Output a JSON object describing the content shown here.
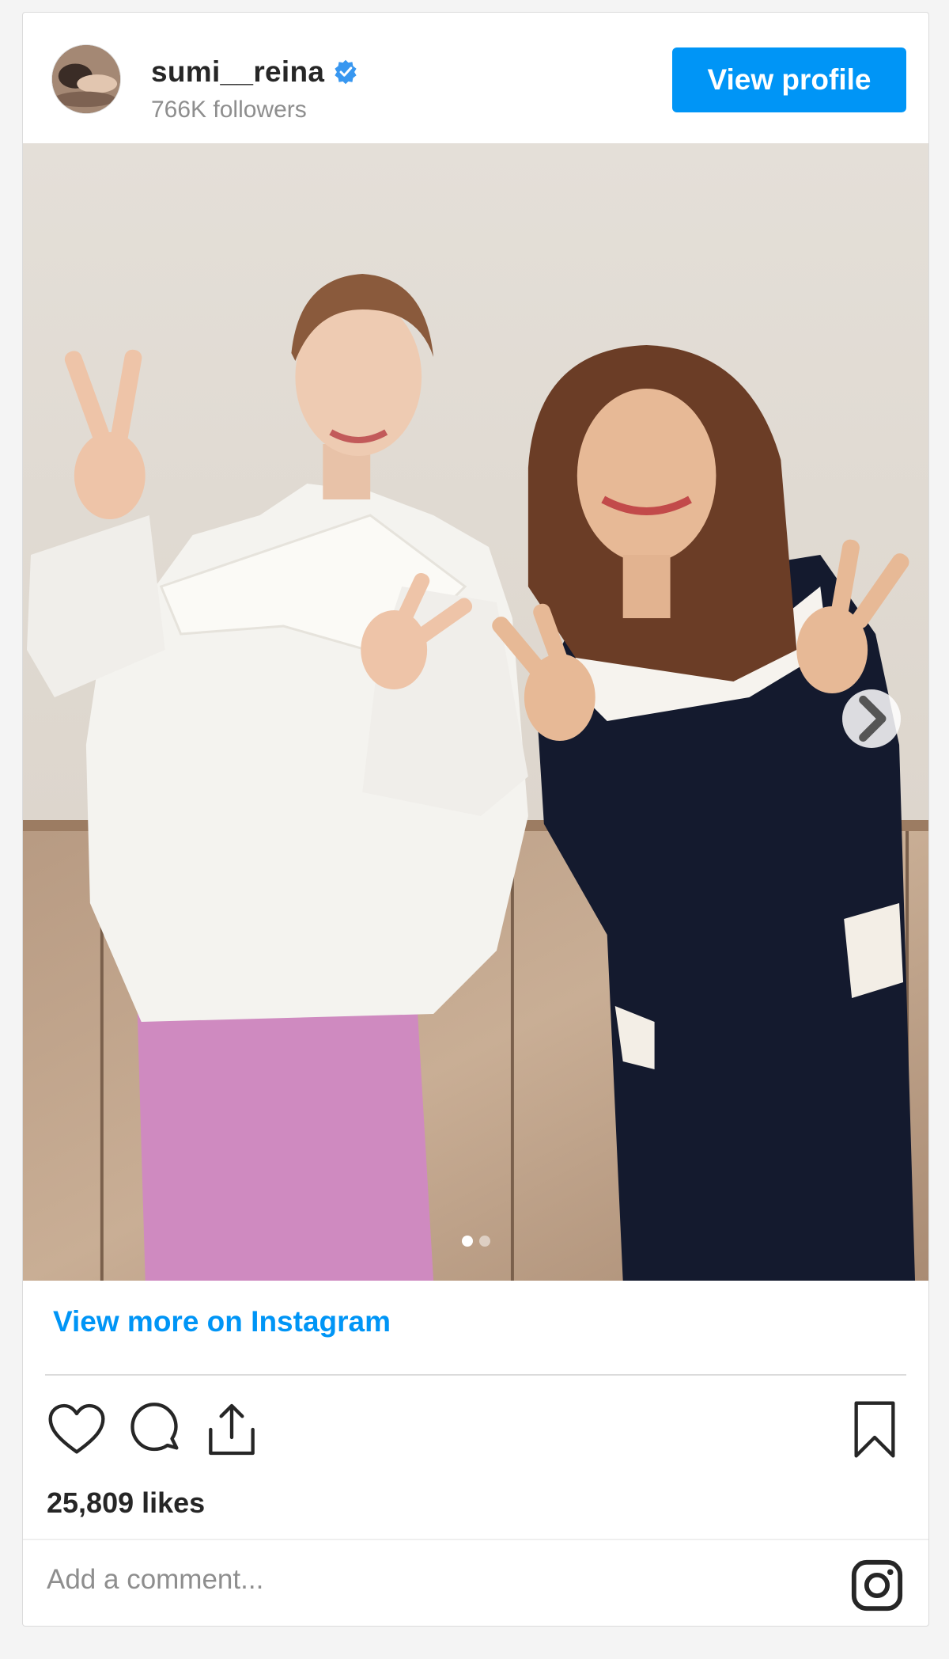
{
  "header": {
    "username": "sumi__reina",
    "followers": "766K followers",
    "view_profile_label": "View profile",
    "verified": true
  },
  "post": {
    "carousel": {
      "total": 2,
      "current": 1
    },
    "view_more_label": "View more on Instagram",
    "likes": "25,809 likes",
    "comment_placeholder": "Add a comment..."
  },
  "colors": {
    "accent": "#0095f6",
    "text": "#262626",
    "muted": "#8e8e8e",
    "border": "#dbdbdb"
  },
  "icons": {
    "like": "heart-icon",
    "comment": "comment-icon",
    "share": "share-icon",
    "save": "bookmark-icon",
    "logo": "instagram-icon",
    "verified": "verified-badge-icon",
    "next": "chevron-right-icon"
  }
}
